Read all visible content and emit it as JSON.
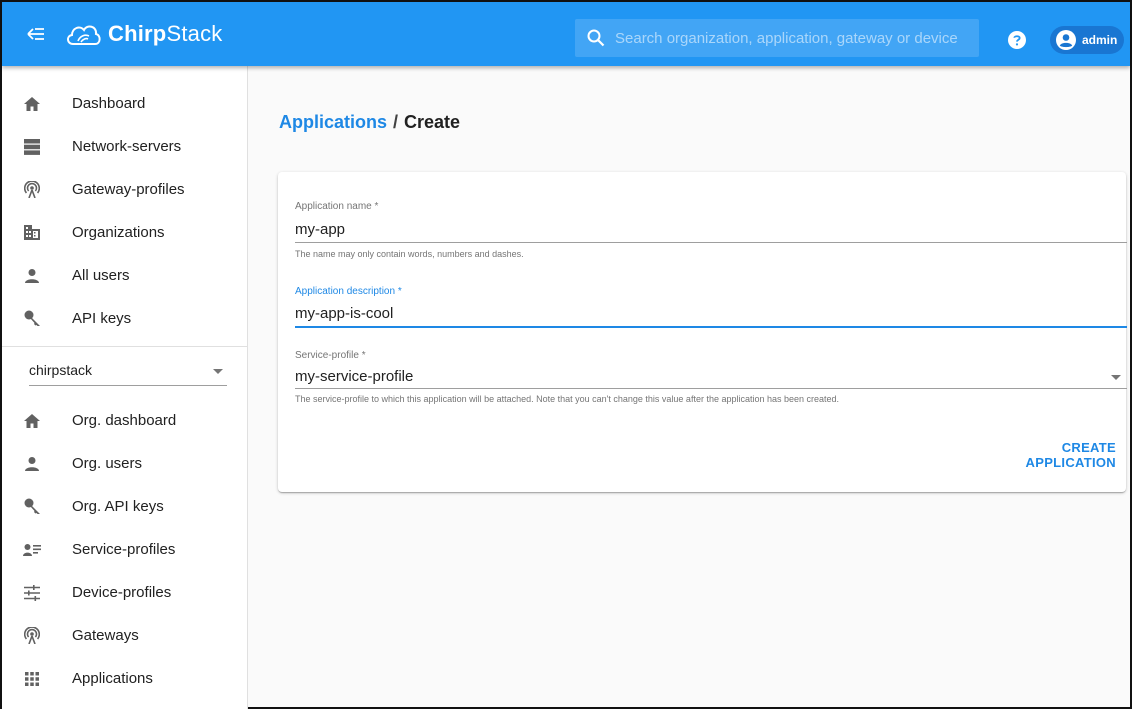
{
  "topbar": {
    "brand_bold": "Chirp",
    "brand_rest": "Stack",
    "search_placeholder": "Search organization, application, gateway or device",
    "user_label": "admin"
  },
  "sidebar": {
    "global_items": [
      {
        "label": "Dashboard",
        "icon": "home-icon"
      },
      {
        "label": "Network-servers",
        "icon": "server-icon"
      },
      {
        "label": "Gateway-profiles",
        "icon": "radio-tower-icon"
      },
      {
        "label": "Organizations",
        "icon": "domain-icon"
      },
      {
        "label": "All users",
        "icon": "person-icon"
      },
      {
        "label": "API keys",
        "icon": "key-icon"
      }
    ],
    "org_selector": {
      "value": "chirpstack"
    },
    "org_items": [
      {
        "label": "Org. dashboard",
        "icon": "home-icon"
      },
      {
        "label": "Org. users",
        "icon": "person-icon"
      },
      {
        "label": "Org. API keys",
        "icon": "key-icon"
      },
      {
        "label": "Service-profiles",
        "icon": "account-details-icon"
      },
      {
        "label": "Device-profiles",
        "icon": "tune-icon"
      },
      {
        "label": "Gateways",
        "icon": "radio-tower-icon"
      },
      {
        "label": "Applications",
        "icon": "apps-icon"
      }
    ]
  },
  "breadcrumb": {
    "parent": "Applications",
    "separator": "/",
    "current": "Create"
  },
  "form": {
    "name": {
      "label": "Application name *",
      "value": "my-app",
      "helper": "The name may only contain words, numbers and dashes."
    },
    "description": {
      "label": "Application description *",
      "value": "my-app-is-cool"
    },
    "service_profile": {
      "label": "Service-profile *",
      "value": "my-service-profile",
      "helper": "The service-profile to which this application will be attached. Note that you can't change this value after the application has been created."
    },
    "submit_label": "CREATE APPLICATION"
  },
  "colors": {
    "primary": "#2196f3",
    "accent": "#1e88e5",
    "search_bg": "#42a5f5",
    "chip_bg": "#1976d2"
  }
}
